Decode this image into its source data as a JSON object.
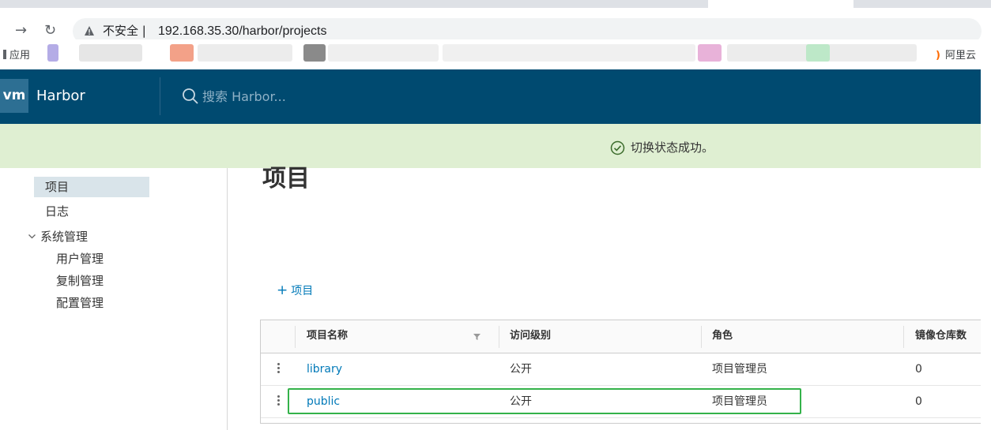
{
  "browser": {
    "security_label": "不安全",
    "url": "192.168.35.30/harbor/projects",
    "bookmarks": {
      "apps_label": "应用",
      "right_label": "阿里云"
    }
  },
  "header": {
    "logo_text": "vm",
    "brand": "Harbor",
    "search_placeholder": "搜索 Harbor..."
  },
  "alert": {
    "message": "切换状态成功。"
  },
  "sidebar": {
    "items": [
      {
        "label": "项目"
      },
      {
        "label": "日志"
      },
      {
        "label": "系统管理"
      }
    ],
    "admin_children": [
      {
        "label": "用户管理"
      },
      {
        "label": "复制管理"
      },
      {
        "label": "配置管理"
      }
    ]
  },
  "main": {
    "title": "项目",
    "new_project_label": "项目",
    "columns": [
      "项目名称",
      "访问级别",
      "角色",
      "镜像仓库数"
    ],
    "rows": [
      {
        "name": "library",
        "access": "公开",
        "role": "项目管理员",
        "repo_count": "0"
      },
      {
        "name": "public",
        "access": "公开",
        "role": "项目管理员",
        "repo_count": "0"
      }
    ]
  },
  "colors": {
    "header_bg": "#004a70",
    "alert_bg": "#dfefd2",
    "link": "#0079b8",
    "highlight": "#34b24a"
  },
  "icons": [
    "arrow-forward-icon",
    "reload-icon",
    "warning-icon",
    "search-icon",
    "check-circle-icon",
    "chevron-down-icon",
    "plus-icon",
    "filter-icon",
    "row-menu-icon"
  ]
}
